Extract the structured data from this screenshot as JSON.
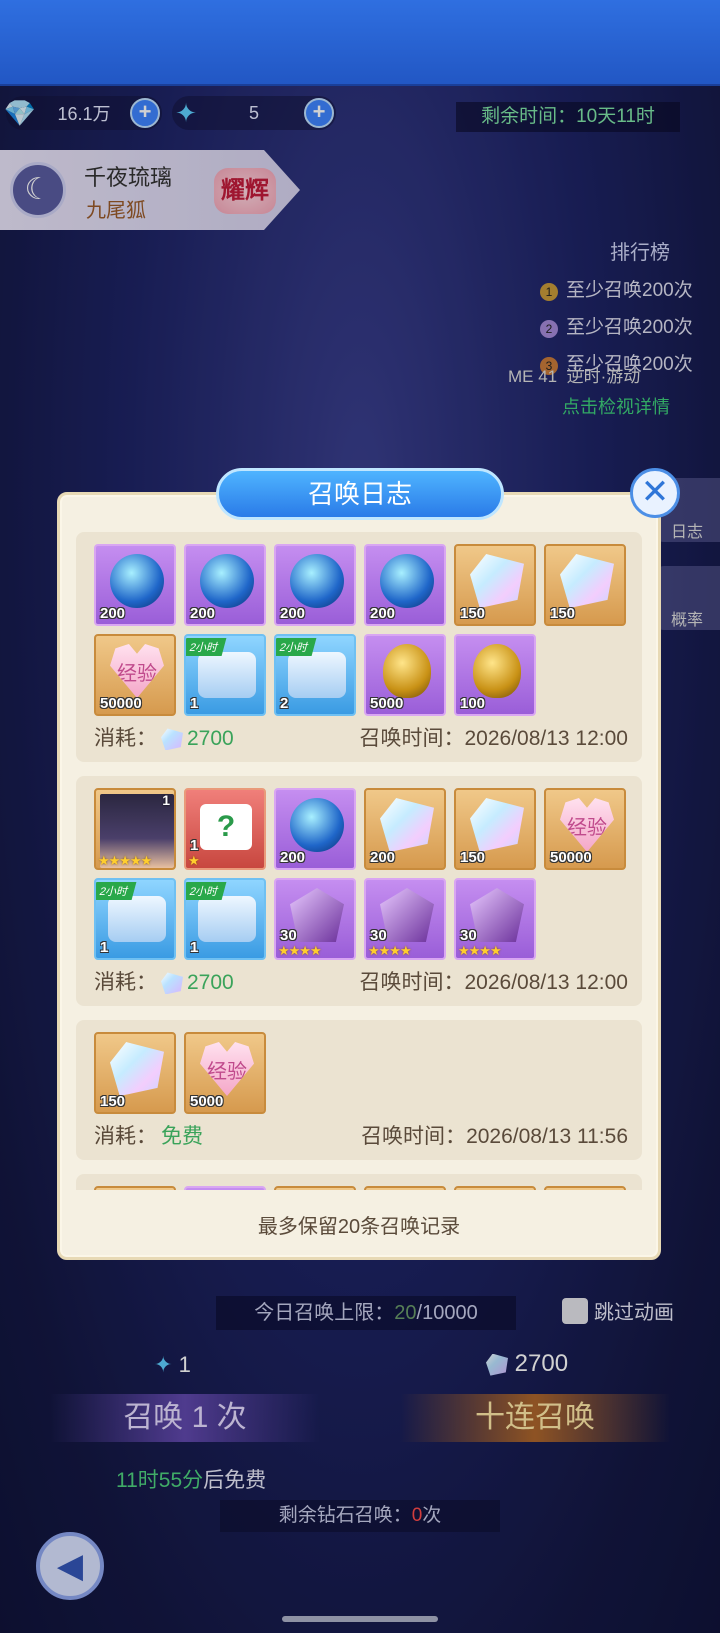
{
  "top_resources": [
    {
      "icon": "crystal-icon",
      "value": "16.1万"
    },
    {
      "icon": "blue-flame-icon",
      "value": "5"
    }
  ],
  "time_left": "剩余时间：10天11时",
  "hero": {
    "name": "千夜琉璃",
    "title": "九尾狐",
    "badge": "耀辉"
  },
  "ranking": {
    "title": "排行榜",
    "rows": [
      "至少召唤200次",
      "至少召唤200次",
      "至少召唤200次"
    ]
  },
  "side_tab": {
    "left": "ME 41",
    "mid": "逆时·游动",
    "link": "点击检视详情"
  },
  "side_buttons": [
    "日志",
    "概率"
  ],
  "bottom": {
    "limit_label": "今日召唤上限：",
    "limit_used": "20",
    "limit_total": "/10000",
    "skip_label": "跳过动画",
    "single_cost": "1",
    "ten_cost": "2700",
    "single_btn": "召唤 1 次",
    "ten_btn": "十连召唤",
    "free_time": "11时55分",
    "free_suffix": "后免费",
    "remain_prefix": "剩余钻石召唤：",
    "remain_count": "0",
    "remain_suffix": "次"
  },
  "dialog": {
    "title": "召唤日志",
    "cost_label": "消耗：",
    "time_label": "召唤时间：",
    "note": "最多保留20条召唤记录",
    "records": [
      {
        "cost": "2700",
        "free": false,
        "time": "2026/08/13 12:00",
        "items": [
          {
            "bg": "purple",
            "icon": "orb",
            "count": "200"
          },
          {
            "bg": "purple",
            "icon": "orb",
            "count": "200"
          },
          {
            "bg": "purple",
            "icon": "orb",
            "count": "200"
          },
          {
            "bg": "purple",
            "icon": "orb",
            "count": "200"
          },
          {
            "bg": "gold",
            "icon": "crystal",
            "count": "150"
          },
          {
            "bg": "gold",
            "icon": "crystal",
            "count": "150"
          },
          {
            "bg": "gold",
            "icon": "heart",
            "count": "50000",
            "label": "经验"
          },
          {
            "bg": "blue",
            "icon": "chest",
            "count": "1",
            "tag": "2小时"
          },
          {
            "bg": "blue",
            "icon": "chest",
            "count": "2",
            "tag": "2小时"
          },
          {
            "bg": "purple",
            "icon": "egg",
            "count": "5000"
          },
          {
            "bg": "purple",
            "icon": "egg",
            "count": "100"
          }
        ]
      },
      {
        "cost": "2700",
        "free": false,
        "time": "2026/08/13 12:00",
        "items": [
          {
            "bg": "gold",
            "icon": "avatar",
            "level": "1",
            "stars": "★★★★★"
          },
          {
            "bg": "red",
            "icon": "mystery",
            "count": "1",
            "stars": "★"
          },
          {
            "bg": "purple",
            "icon": "orb",
            "count": "200"
          },
          {
            "bg": "gold",
            "icon": "crystal",
            "count": "200"
          },
          {
            "bg": "gold",
            "icon": "crystal",
            "count": "150"
          },
          {
            "bg": "gold",
            "icon": "heart",
            "count": "50000",
            "label": "经验"
          },
          {
            "bg": "blue",
            "icon": "chest",
            "count": "1",
            "tag": "2小时"
          },
          {
            "bg": "blue",
            "icon": "chest",
            "count": "1",
            "tag": "2小时"
          },
          {
            "bg": "purple",
            "icon": "shard",
            "count": "30",
            "stars": "★★★★"
          },
          {
            "bg": "purple",
            "icon": "shard",
            "count": "30",
            "stars": "★★★★"
          },
          {
            "bg": "purple",
            "icon": "shard",
            "count": "30",
            "stars": "★★★★"
          }
        ]
      },
      {
        "cost": "免费",
        "free": true,
        "time": "2026/08/13 11:56",
        "items": [
          {
            "bg": "gold",
            "icon": "crystal",
            "count": "150"
          },
          {
            "bg": "gold",
            "icon": "heart",
            "count": "5000",
            "label": "经验"
          }
        ]
      },
      {
        "cost": "",
        "free": false,
        "time": "",
        "items": [
          {
            "bg": "gold",
            "icon": "avatar"
          },
          {
            "bg": "purple",
            "icon": "orb"
          },
          {
            "bg": "gold",
            "icon": "crystal"
          },
          {
            "bg": "gold",
            "icon": "crystal"
          },
          {
            "bg": "gold",
            "icon": "crystal"
          },
          {
            "bg": "gold",
            "icon": "heart"
          }
        ]
      }
    ]
  }
}
